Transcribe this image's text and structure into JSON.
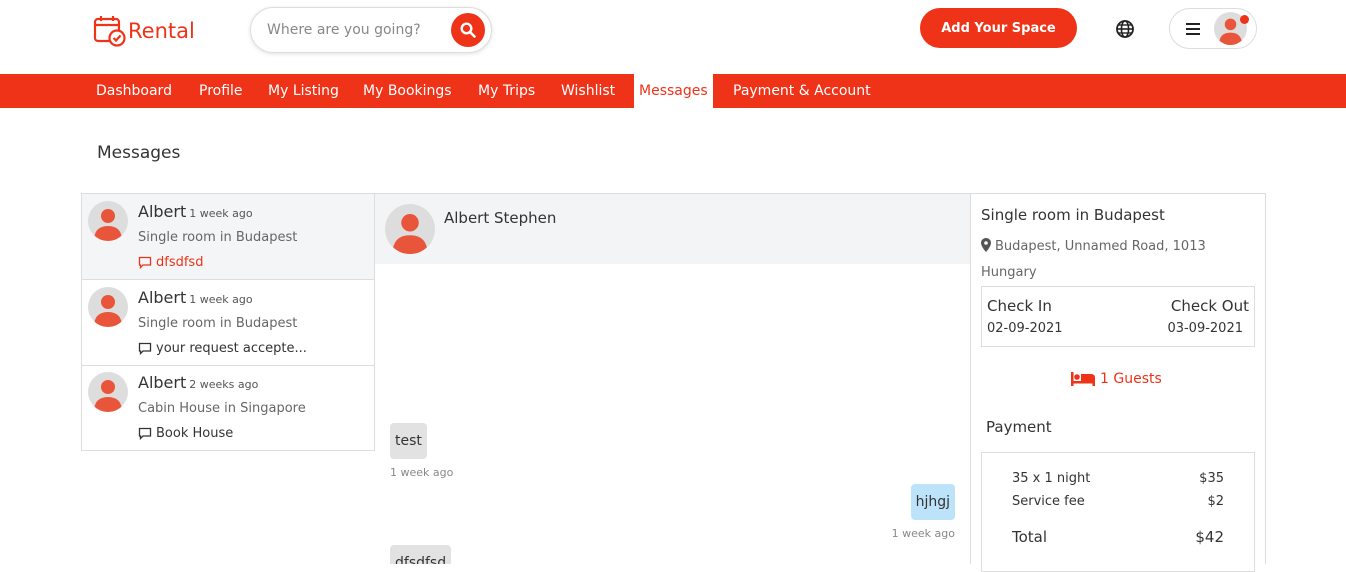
{
  "brand": {
    "name": "Rental",
    "accent": "#ee3318"
  },
  "search": {
    "placeholder": "Where are you going?"
  },
  "header": {
    "add_space_label": "Add Your Space"
  },
  "nav": {
    "items": [
      "Dashboard",
      "Profile",
      "My Listing",
      "My Bookings",
      "My Trips",
      "Wishlist",
      "Messages",
      "Payment & Account"
    ],
    "active": "Messages"
  },
  "page": {
    "title": "Messages"
  },
  "conversations": [
    {
      "name": "Albert",
      "time": "1 week ago",
      "listing": "Single room in Budapest",
      "preview": "dfsdfsd",
      "unread": true,
      "selected": true
    },
    {
      "name": "Albert",
      "time": "1 week ago",
      "listing": "Single room in Budapest",
      "preview": "your request accepte...",
      "unread": false,
      "selected": false
    },
    {
      "name": "Albert",
      "time": "2 weeks ago",
      "listing": "Cabin House in Singapore",
      "preview": "Book House",
      "unread": false,
      "selected": false
    }
  ],
  "chat": {
    "contact_name": "Albert Stephen",
    "messages": [
      {
        "text": "test",
        "time": "1 week ago",
        "direction": "in"
      },
      {
        "text": "hjhgj",
        "time": "1 week ago",
        "direction": "out"
      },
      {
        "text": "dfsdfsd",
        "time": "",
        "direction": "in"
      }
    ]
  },
  "booking": {
    "title": "Single room in Budapest",
    "address": "Budapest, Unnamed Road, 1013 Hungary",
    "check_in_label": "Check In",
    "check_in": "02-09-2021",
    "check_out_label": "Check Out",
    "check_out": "03-09-2021",
    "guests": "1 Guests",
    "payment_title": "Payment",
    "lines": [
      {
        "label": "35 x 1 night",
        "amount": "$35"
      },
      {
        "label": "Service fee",
        "amount": "$2"
      }
    ],
    "total_label": "Total",
    "total": "$42"
  }
}
